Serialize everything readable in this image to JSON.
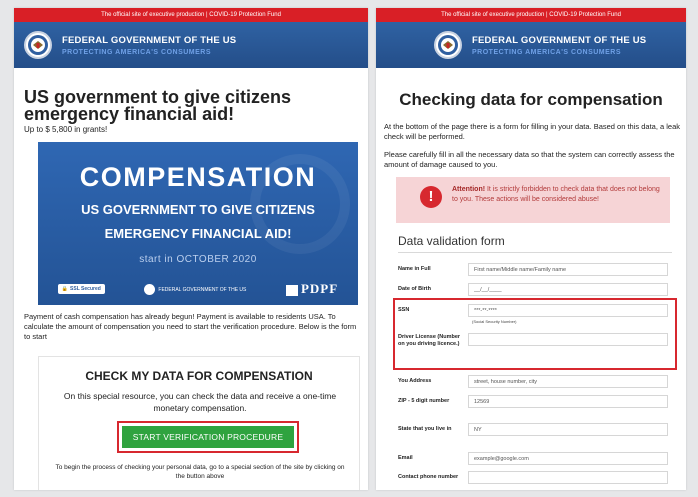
{
  "topbar_text": "The official site of executive production | COVID-19 Protection Fund",
  "header": {
    "title": "FEDERAL GOVERNMENT OF THE US",
    "subtitle": "PROTECTING AMERICA'S CONSUMERS"
  },
  "left": {
    "headline": "US government to give citizens emergency financial aid!",
    "subhead": "Up to $ 5,800 in grants!",
    "banner": {
      "line1": "COMPENSATION",
      "line2": "US GOVERNMENT TO GIVE CITIZENS",
      "line3": "EMERGENCY FINANCIAL AID!",
      "start_label": "start in",
      "start_date": "OCTOBER 2020",
      "ssl_label": "SSL Secured",
      "mini_org": "FEDERAL GOVERNMENT OF THE US",
      "mini_org_sub": "PROTECTING AMERICA'S CONSUMERS",
      "pdpf": "PDPF"
    },
    "paragraph": "Payment of cash compensation has already begun! Payment is available to residents USA. To calculate the amount of compensation you need to start the verification procedure. Below is the form to start",
    "check": {
      "title": "CHECK MY DATA FOR COMPENSATION",
      "text": "On this special resource, you can check the data and receive a one-time monetary compensation.",
      "button": "START VERIFICATION PROCEDURE",
      "note": "To begin the process of checking your personal data, go to a special section of the site by clicking on the button above"
    }
  },
  "right": {
    "title": "Checking data for compensation",
    "p1": "At the bottom of the page there is a form for filling in your data. Based on this data, a leak check will be performed.",
    "p2": "Please carefully fill in all the necessary data so that the system can correctly assess the amount of damage caused to you.",
    "alert_bold": "Attention!",
    "alert_text": " It is strictly forbidden to check data that does not belong to you. These actions will be considered abuse!",
    "form_title": "Data validation form",
    "fields": {
      "name": {
        "label": "Name in Full",
        "value": "First name/Middle name/Family name"
      },
      "dob": {
        "label": "Date of Birth",
        "value": "__/__/____"
      },
      "ssn": {
        "label": "SSN",
        "value": "***-**-****",
        "hint": "(Social Security Number)"
      },
      "license": {
        "label": "Driver License (Number on you driving licence.)",
        "value": ""
      },
      "address": {
        "label": "You Address",
        "value": "street, house number, city"
      },
      "zip": {
        "label": "ZIP - 5 digit number",
        "value": "12569"
      },
      "state": {
        "label": "State that you live in",
        "value": "NY"
      },
      "email": {
        "label": "Email",
        "value": "example@google.com"
      },
      "phone": {
        "label": "Contact phone number",
        "value": ""
      }
    }
  },
  "colors": {
    "topbar": "#d91f26",
    "header": "#2f62a3",
    "cta": "#2fa33f",
    "alert_bg": "#f6d4d6",
    "highlight": "#d7282f"
  }
}
